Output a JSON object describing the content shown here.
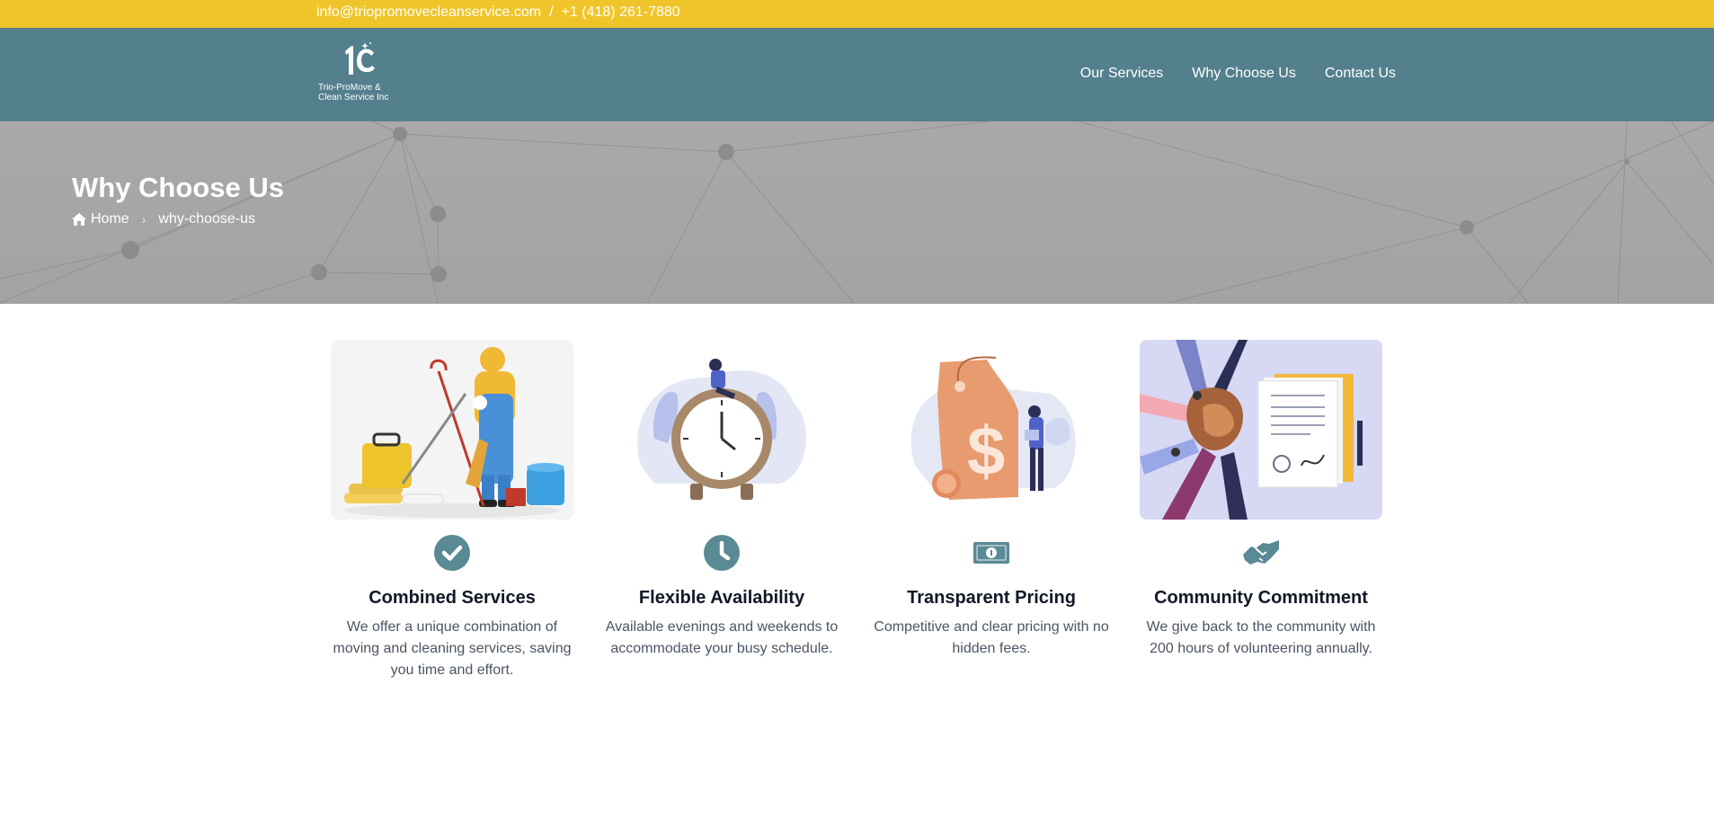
{
  "topbar": {
    "email": "info@triopromovecleanservice.com",
    "separator": "/",
    "phone": "+1 (418) 261-7880"
  },
  "brand": {
    "logo_line1": "Trio-ProMove &",
    "logo_line2": "Clean Service Inc"
  },
  "nav": {
    "items": [
      "Our Services",
      "Why Choose Us",
      "Contact Us"
    ]
  },
  "hero": {
    "title": "Why Choose Us",
    "breadcrumb_home": "Home",
    "breadcrumb_current": "why-choose-us"
  },
  "features": [
    {
      "title": "Combined Services",
      "text": "We offer a unique combination of moving and cleaning services, saving you time and effort.",
      "icon": "check-circle-icon"
    },
    {
      "title": "Flexible Availability",
      "text": "Available evenings and weekends to accommodate your busy schedule.",
      "icon": "clock-icon"
    },
    {
      "title": "Transparent Pricing",
      "text": "Competitive and clear pricing with no hidden fees.",
      "icon": "money-bill-icon"
    },
    {
      "title": "Community Commitment",
      "text": "We give back to the community with 200 hours of volunteering annually.",
      "icon": "handshake-icon"
    }
  ],
  "colors": {
    "topbar": "#f0c52a",
    "header": "#547f8d",
    "accent": "#5a8a93",
    "hero": "#a8a8a8"
  }
}
